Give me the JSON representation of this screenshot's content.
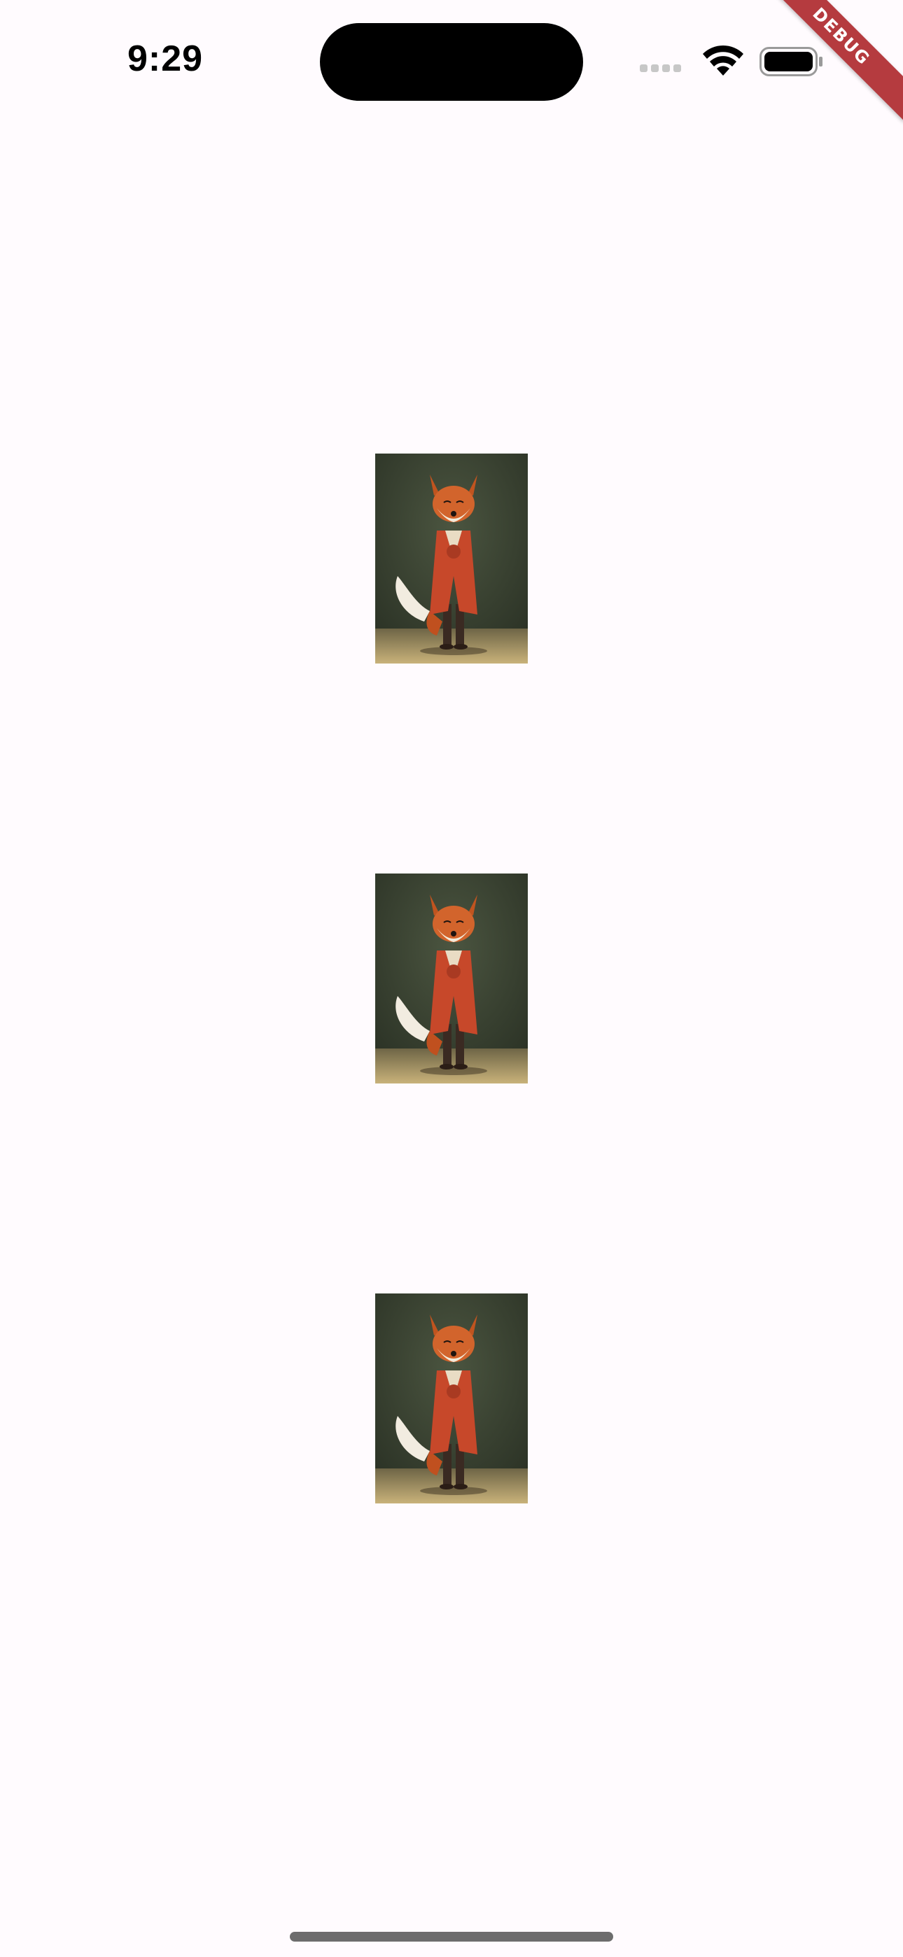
{
  "status_bar": {
    "time": "9:29",
    "icons": [
      "cellular-signal-icon",
      "wifi-icon",
      "battery-icon"
    ]
  },
  "debug_banner": {
    "label": "DEBUG",
    "color": "#b53b3f"
  },
  "images": [
    {
      "subject": "fox-character-in-red-coat"
    },
    {
      "subject": "fox-character-in-red-coat"
    },
    {
      "subject": "fox-character-in-red-coat"
    }
  ],
  "colors": {
    "background": "#fffbfe",
    "image_bg": "#3a4331"
  }
}
